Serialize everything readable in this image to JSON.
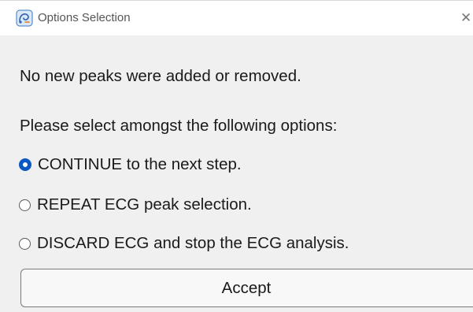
{
  "window": {
    "title": "Options Selection",
    "close_glyph": "✕",
    "icon": "app-icon"
  },
  "message": {
    "line1": "No new peaks were added or removed.",
    "line2": "Please select amongst the following options:"
  },
  "options": [
    {
      "label": "CONTINUE to the next step.",
      "selected": true
    },
    {
      "label": "REPEAT ECG peak selection.",
      "selected": false
    },
    {
      "label": "DISCARD ECG and stop the ECG analysis.",
      "selected": false
    }
  ],
  "accept_button": {
    "label": "Accept"
  },
  "colors": {
    "accent": "#0a58c4",
    "background": "#f0f0f0",
    "titlebar": "#ffffff"
  }
}
